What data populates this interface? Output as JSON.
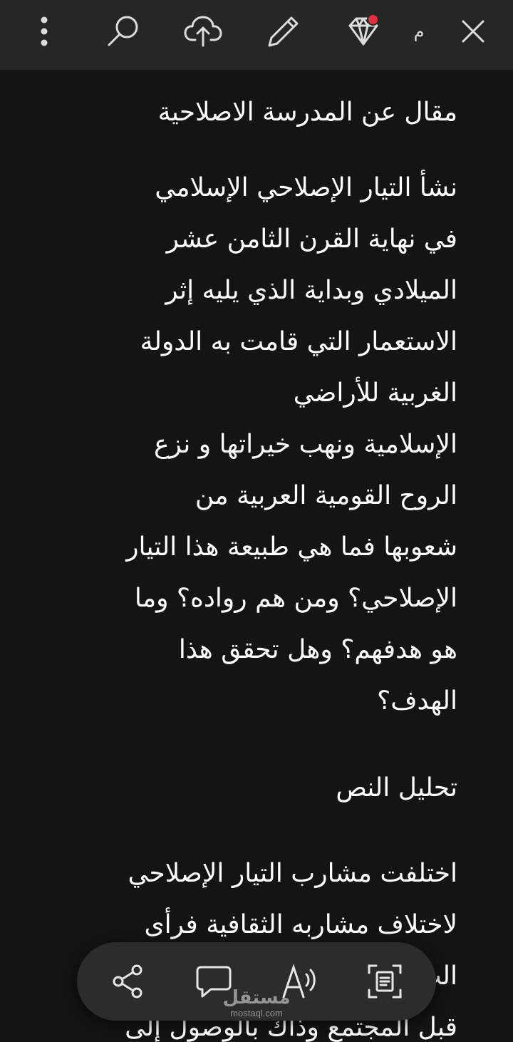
{
  "toolbar": {
    "more_icon": "more-vertical-icon",
    "search_icon": "search-icon",
    "upload_icon": "cloud-upload-icon",
    "edit_icon": "pencil-icon",
    "premium_icon": "diamond-icon",
    "account_initial": "م",
    "close_icon": "close-icon",
    "badge_color": "#e0303c"
  },
  "document": {
    "title": "مقال عن المدرسة الاصلاحية",
    "intro_lines": [
      "نشأ التيار الإصلاحي الإسلامي",
      "في نهاية القرن الثامن عشر",
      "الميلادي وبداية الذي يليه إثر",
      "الاستعمار التي قامت به الدولة",
      "الغربية للأراضي",
      "الإسلامية  ونهب خيراتها و نزع",
      "الروح القومية العربية  من",
      "شعوبها فما هي طبيعة هذا التيار",
      "الإصلاحي؟ ومن هم رواده؟ وما",
      "هو هدفهم؟  وهل تحقق هذا",
      "الهدف؟"
    ],
    "section_heading": "تحليل النص",
    "analysis_lines": [
      "اختلفت مشارب التيار الإصلاحي",
      "لاختلاف مشاربه الثقافية فرأى",
      "الب",
      "قبل المجتمع وذاك بالوصول إلى"
    ]
  },
  "floating_toolbar": {
    "share_icon": "share-icon",
    "comment_icon": "comment-icon",
    "read_aloud_icon": "read-aloud-icon",
    "scan_text_icon": "scan-text-icon"
  },
  "watermark": {
    "word": "مستقل",
    "url": "mostaql.com"
  }
}
